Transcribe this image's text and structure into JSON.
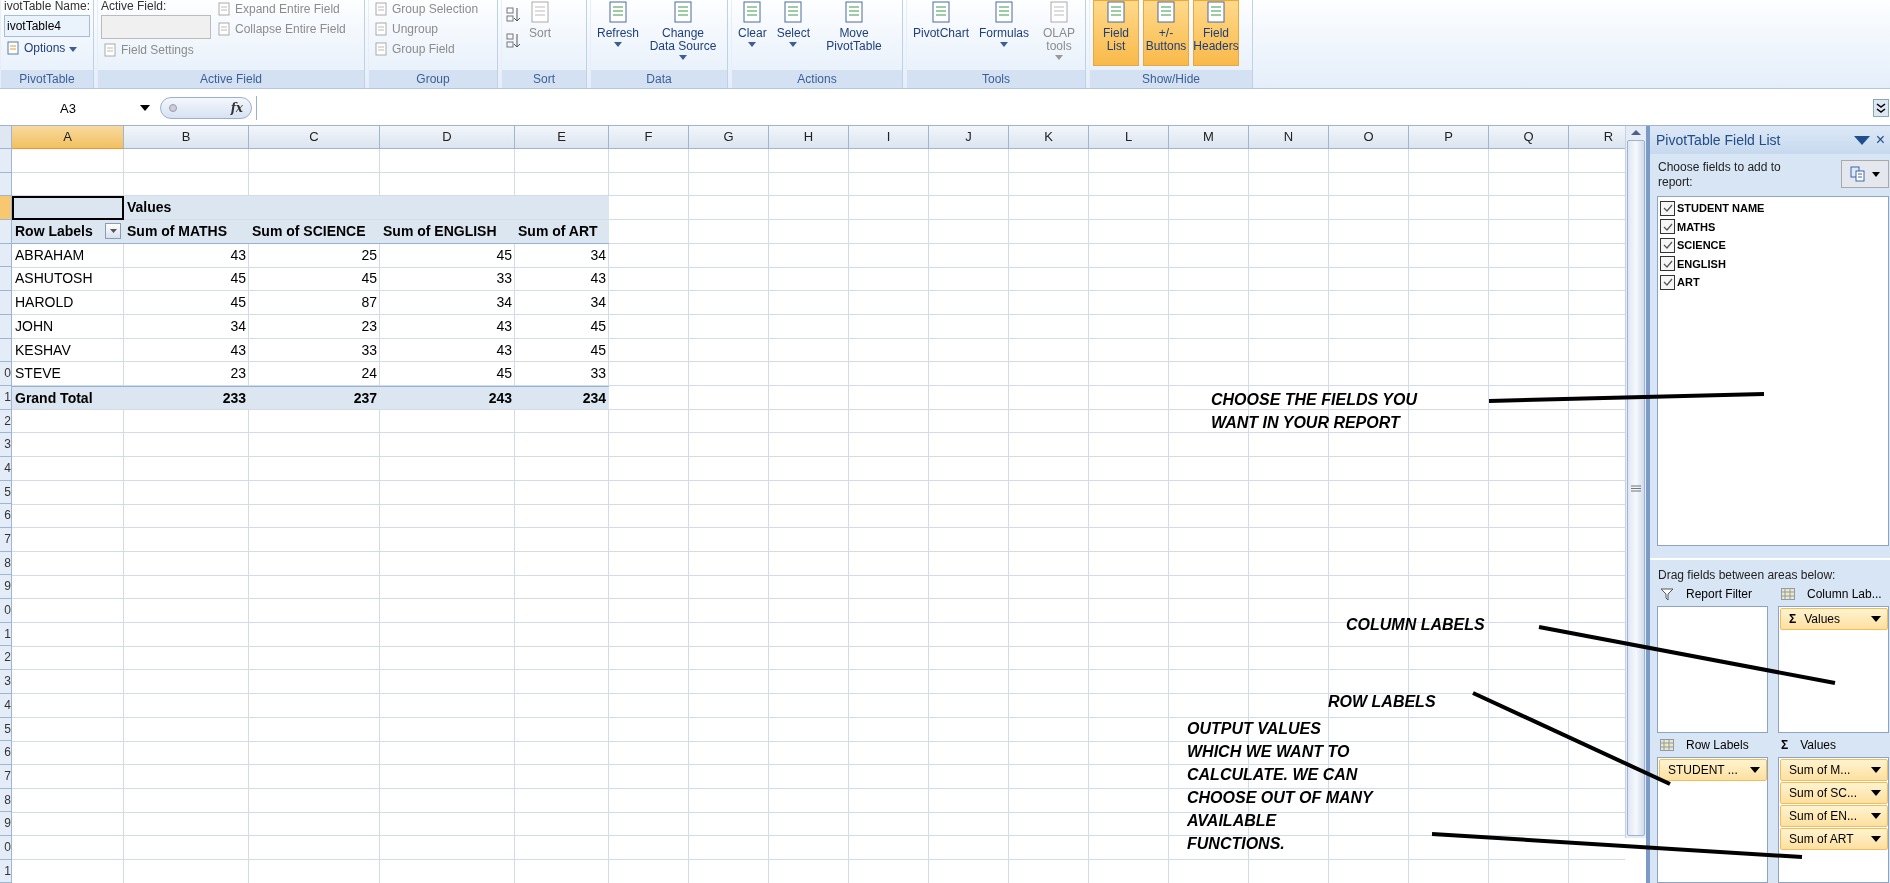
{
  "ribbon": {
    "groups": [
      {
        "label": "PivotTable",
        "columns": [
          [
            {
              "kind": "caption",
              "label": "ivotTable Name:"
            },
            {
              "kind": "field",
              "value": "ivotTable4",
              "disabled": false
            },
            {
              "kind": "small",
              "label": "Options",
              "dropdown": true,
              "disabled": false
            }
          ]
        ]
      },
      {
        "label": "Active Field",
        "columns": [
          [
            {
              "kind": "caption",
              "label": "Active Field:"
            },
            {
              "kind": "field",
              "disabled": true
            },
            {
              "kind": "small",
              "label": "Field Settings",
              "dropdown": false,
              "disabled": true
            }
          ],
          [
            {
              "kind": "small",
              "label": "Expand Entire Field",
              "dropdown": false,
              "disabled": true
            },
            {
              "kind": "small",
              "label": "Collapse Entire Field",
              "dropdown": false,
              "disabled": true
            }
          ]
        ]
      },
      {
        "label": "Group",
        "columns": [
          [
            {
              "kind": "small",
              "label": "Group Selection",
              "dropdown": false,
              "disabled": true
            },
            {
              "kind": "small",
              "label": "Ungroup",
              "dropdown": false,
              "disabled": true
            },
            {
              "kind": "small",
              "label": "Group Field",
              "dropdown": false,
              "disabled": true
            }
          ]
        ]
      },
      {
        "label": "Sort",
        "columns": [
          [
            {
              "kind": "icon"
            },
            {
              "kind": "icon"
            }
          ],
          [
            {
              "kind": "large",
              "label": "Sort",
              "dropdown": false,
              "disabled": true,
              "on": false
            }
          ]
        ]
      },
      {
        "label": "Data",
        "columns": [
          [
            {
              "kind": "large",
              "label": "Refresh",
              "dropdown": true,
              "disabled": false,
              "on": false
            }
          ],
          [
            {
              "kind": "large",
              "label": "Change Data Source",
              "dropdown": true,
              "disabled": false,
              "on": false
            }
          ]
        ]
      },
      {
        "label": "Actions",
        "columns": [
          [
            {
              "kind": "large",
              "label": "Clear",
              "dropdown": true,
              "disabled": false,
              "on": false
            }
          ],
          [
            {
              "kind": "large",
              "label": "Select",
              "dropdown": true,
              "disabled": false,
              "on": false
            }
          ],
          [
            {
              "kind": "large",
              "label": "Move PivotTable",
              "dropdown": false,
              "disabled": false,
              "on": false
            }
          ]
        ]
      },
      {
        "label": "Tools",
        "columns": [
          [
            {
              "kind": "large",
              "label": "PivotChart",
              "dropdown": false,
              "disabled": false,
              "on": false
            }
          ],
          [
            {
              "kind": "large",
              "label": "Formulas",
              "dropdown": true,
              "disabled": false,
              "on": false
            }
          ],
          [
            {
              "kind": "large",
              "label": "OLAP tools",
              "dropdown": true,
              "disabled": true,
              "on": false
            }
          ]
        ]
      },
      {
        "label": "Show/Hide",
        "columns": [
          [
            {
              "kind": "large",
              "label": "Field List",
              "dropdown": false,
              "disabled": false,
              "on": true
            }
          ],
          [
            {
              "kind": "large",
              "label": "+/- Buttons",
              "dropdown": false,
              "disabled": false,
              "on": true
            }
          ],
          [
            {
              "kind": "large",
              "label": "Field Headers",
              "dropdown": false,
              "disabled": false,
              "on": true
            }
          ]
        ]
      }
    ]
  },
  "formula_bar": {
    "name_box": "A3",
    "fx": "fx"
  },
  "sheet": {
    "columns": [
      {
        "label": "A",
        "selected": true
      },
      {
        "label": "B",
        "selected": false
      },
      {
        "label": "C",
        "selected": false
      },
      {
        "label": "D",
        "selected": false
      },
      {
        "label": "E",
        "selected": false
      },
      {
        "label": "F",
        "selected": false
      },
      {
        "label": "G",
        "selected": false
      },
      {
        "label": "H",
        "selected": false
      },
      {
        "label": "I",
        "selected": false
      },
      {
        "label": "J",
        "selected": false
      },
      {
        "label": "K",
        "selected": false
      },
      {
        "label": "L",
        "selected": false
      },
      {
        "label": "M",
        "selected": false
      },
      {
        "label": "N",
        "selected": false
      },
      {
        "label": "O",
        "selected": false
      },
      {
        "label": "P",
        "selected": false
      },
      {
        "label": "Q",
        "selected": false
      },
      {
        "label": "R",
        "selected": false
      }
    ],
    "row_headers": [
      {
        "selected": false
      },
      {
        "selected": false
      },
      {
        "selected": true
      },
      {
        "selected": false
      },
      {
        "selected": false
      },
      {
        "selected": false
      },
      {
        "selected": false
      },
      {
        "selected": false
      },
      {
        "selected": false
      },
      {
        "label": "0",
        "selected": false
      },
      {
        "label": "1",
        "selected": false
      },
      {
        "label": "2",
        "selected": false
      },
      {
        "label": "3",
        "selected": false
      },
      {
        "label": "4",
        "selected": false
      },
      {
        "label": "5",
        "selected": false
      },
      {
        "label": "6",
        "selected": false
      },
      {
        "label": "7",
        "selected": false
      },
      {
        "label": "8",
        "selected": false
      },
      {
        "label": "9",
        "selected": false
      },
      {
        "label": "0",
        "selected": false
      },
      {
        "label": "1",
        "selected": false
      },
      {
        "label": "2",
        "selected": false
      },
      {
        "label": "3",
        "selected": false
      },
      {
        "label": "4",
        "selected": false
      },
      {
        "label": "5",
        "selected": false
      },
      {
        "label": "6",
        "selected": false
      },
      {
        "label": "7",
        "selected": false
      },
      {
        "label": "8",
        "selected": false
      },
      {
        "label": "9",
        "selected": false
      },
      {
        "label": "0",
        "selected": false
      },
      {
        "label": "1",
        "selected": false
      }
    ],
    "pivot": {
      "values_caption": "Values",
      "row_labels": "Row Labels",
      "headers": [
        "Sum of MATHS",
        "Sum of SCIENCE",
        "Sum of ENGLISH",
        "Sum of ART"
      ],
      "rows": [
        {
          "label": "ABRAHAM",
          "values": [
            "43",
            "25",
            "45",
            "34"
          ]
        },
        {
          "label": "ASHUTOSH",
          "values": [
            "45",
            "45",
            "33",
            "43"
          ]
        },
        {
          "label": "HAROLD",
          "values": [
            "45",
            "87",
            "34",
            "34"
          ]
        },
        {
          "label": "JOHN",
          "values": [
            "34",
            "23",
            "43",
            "45"
          ]
        },
        {
          "label": "KESHAV",
          "values": [
            "43",
            "33",
            "43",
            "45"
          ]
        },
        {
          "label": "STEVE",
          "values": [
            "23",
            "24",
            "45",
            "33"
          ]
        }
      ],
      "total": {
        "label": "Grand Total",
        "values": [
          "233",
          "237",
          "243",
          "234"
        ]
      }
    }
  },
  "field_list": {
    "title": "PivotTable Field List",
    "close": "×",
    "prompt": "Choose fields to add to report:",
    "fields": [
      {
        "label": "STUDENT NAME",
        "checked": true
      },
      {
        "label": "MATHS",
        "checked": true
      },
      {
        "label": "SCIENCE",
        "checked": true
      },
      {
        "label": "ENGLISH",
        "checked": true
      },
      {
        "label": "ART",
        "checked": true
      }
    ],
    "areas_prompt": "Drag fields between areas below:",
    "areas": [
      {
        "title": "Report Filter",
        "kind": "filter"
      },
      {
        "title": "Column Lab...",
        "kind": "grid",
        "items": [
          {
            "symbol": "Σ",
            "label": "Values"
          }
        ]
      },
      {
        "title": "Row Labels",
        "kind": "grid",
        "items": [
          {
            "label": "STUDENT ..."
          }
        ]
      },
      {
        "title": "Values",
        "kind": "sum",
        "symbol": "Σ",
        "items": [
          {
            "label": "Sum of M..."
          },
          {
            "label": "Sum of SC..."
          },
          {
            "label": "Sum of EN..."
          },
          {
            "label": "Sum of ART"
          }
        ]
      }
    ]
  },
  "annotations": [
    {
      "lines": [
        "CHOOSE THE FIELDS YOU",
        "WANT IN YOUR REPORT"
      ]
    },
    {
      "lines": [
        "COLUMN LABELS"
      ]
    },
    {
      "lines": [
        "ROW LABELS"
      ]
    },
    {
      "lines": [
        "OUTPUT VALUES",
        "WHICH WE WANT TO",
        "CALCULATE. WE CAN",
        "CHOOSE OUT OF MANY",
        "AVAILABLE",
        "FUNCTIONS."
      ]
    }
  ]
}
